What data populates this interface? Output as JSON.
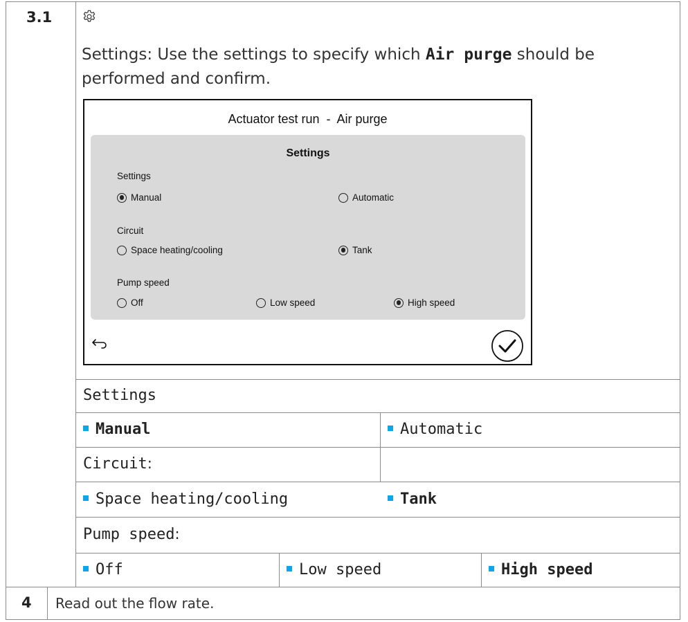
{
  "step_3_1": {
    "number": "3.1",
    "icon": "gear-icon",
    "intro_prefix": "Settings: Use the settings to specify which ",
    "intro_code": "Air purge",
    "intro_suffix": " should be performed and confirm."
  },
  "screen": {
    "title": "Actuator test run  -  Air purge",
    "panel_title": "Settings",
    "settings_label": "Settings",
    "settings_options": [
      {
        "label": "Manual",
        "selected": true
      },
      {
        "label": "Automatic",
        "selected": false
      }
    ],
    "circuit_label": "Circuit",
    "circuit_options": [
      {
        "label": "Space heating/cooling",
        "selected": false
      },
      {
        "label": "Tank",
        "selected": true
      }
    ],
    "pump_label": "Pump speed",
    "pump_options": [
      {
        "label": "Off",
        "selected": false
      },
      {
        "label": "Low speed",
        "selected": false
      },
      {
        "label": "High speed",
        "selected": true
      }
    ],
    "back_icon": "back-arrow-icon",
    "confirm_icon": "checkmark-circle-icon"
  },
  "table": {
    "settings_header": "Settings",
    "manual": "Manual",
    "automatic": "Automatic",
    "circuit_header": "Circuit",
    "circuit_colon": ":",
    "space_heating": "Space heating/cooling",
    "tank": "Tank",
    "pump_header": "Pump speed",
    "pump_colon": ":",
    "off": "Off",
    "low_speed": "Low speed",
    "high_speed": "High speed",
    "bullet_color": "#0ea5e9"
  },
  "step_4": {
    "number": "4",
    "text": "Read out the flow rate."
  }
}
